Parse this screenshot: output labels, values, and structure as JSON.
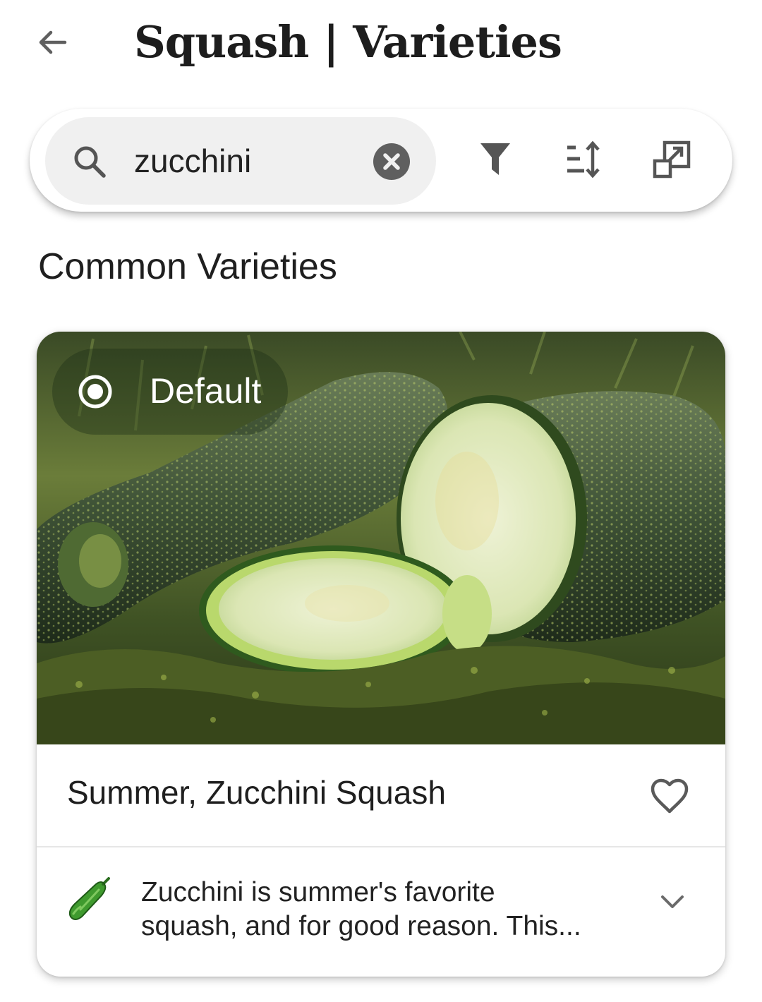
{
  "header": {
    "title": "Squash | Varieties",
    "back_icon": "arrow-left-icon"
  },
  "search": {
    "value": "zucchini",
    "placeholder": "",
    "search_icon": "search-icon",
    "clear_icon": "clear-circle-icon"
  },
  "toolbar": {
    "filter_icon": "filter-icon",
    "sort_icon": "sort-icon",
    "open_icon": "open-in-new-icon"
  },
  "section": {
    "title": "Common Varieties"
  },
  "card": {
    "chip_label": "Default",
    "chip_selected": true,
    "name": "Summer, Zucchini Squash",
    "favorite": false,
    "description_line1": "Zucchini is summer's favorite",
    "description_line2": "squash, and for good reason. This...",
    "expand_icon": "chevron-down-icon"
  },
  "colors": {
    "accent_green": "#3f8f2a",
    "chip_bg": "rgba(25,45,20,0.38)",
    "icon_gray": "#555555"
  }
}
